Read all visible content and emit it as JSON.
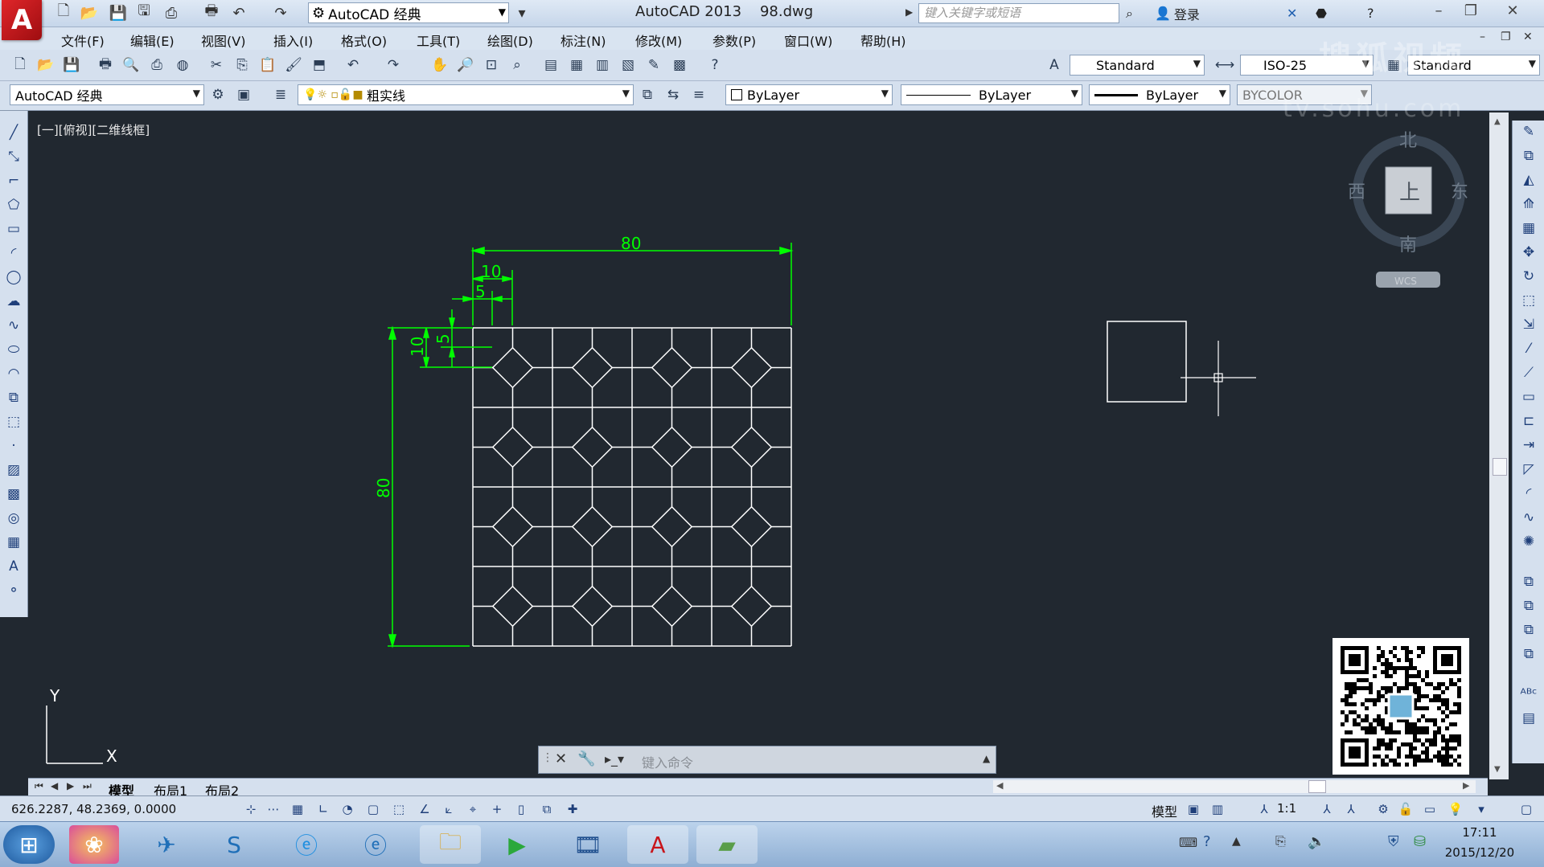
{
  "titlebar": {
    "workspace": "AutoCAD 经典",
    "title": "AutoCAD 2013    98.dwg",
    "search_placeholder": "键入关键字或短语",
    "login": "登录"
  },
  "menu": [
    "文件(F)",
    "编辑(E)",
    "视图(V)",
    "插入(I)",
    "格式(O)",
    "工具(T)",
    "绘图(D)",
    "标注(N)",
    "修改(M)",
    "参数(P)",
    "窗口(W)",
    "帮助(H)"
  ],
  "styles": {
    "text_style": "Standard",
    "dim_style": "ISO-25",
    "table_style": "Standard"
  },
  "toolbar2": {
    "workspace": "AutoCAD 经典",
    "layer": "粗实线",
    "color": "ByLayer",
    "linetype": "ByLayer",
    "lineweight": "ByLayer",
    "plotstyle": "BYCOLOR"
  },
  "viewport": {
    "label": "[一][俯视][二维线框]"
  },
  "drawing": {
    "dims": {
      "width_total": "80",
      "offset_10": "10",
      "offset_5": "5",
      "height_total": "80",
      "v_10": "10",
      "v_5": "5"
    },
    "colors": {
      "lines": "#ffffff",
      "dims": "#00ff00",
      "background": "#212830"
    }
  },
  "compass": {
    "north": "北",
    "south": "南",
    "east": "东",
    "west": "西",
    "center": "上",
    "wcs": "WCS"
  },
  "ucs": {
    "x": "X",
    "y": "Y"
  },
  "tabs": [
    "模型",
    "布局1",
    "布局2"
  ],
  "command": {
    "placeholder": "键入命令"
  },
  "status": {
    "coords": "626.2287, 48.2369, 0.0000",
    "model": "模型",
    "scale": "1:1"
  },
  "watermark": {
    "line1": "搜狐视频",
    "line2": "tv.sohu.com"
  },
  "clock": {
    "time": "17:11",
    "date": "2015/12/20"
  }
}
